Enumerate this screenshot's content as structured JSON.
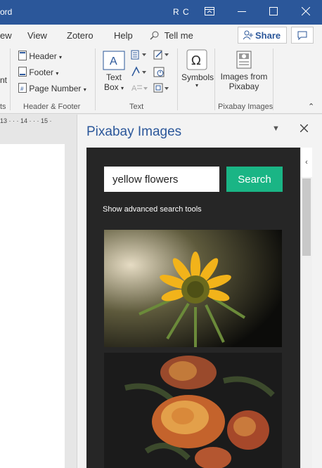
{
  "titlebar": {
    "app_title": "ord",
    "user_initials": "R C",
    "colors": {
      "bg": "#2b579a",
      "fg": "#ffffff"
    }
  },
  "tabs": {
    "items": [
      "ew",
      "View",
      "Zotero",
      "Help"
    ],
    "tell_me": "Tell me",
    "share": "Share"
  },
  "ribbon": {
    "insert": {
      "cut_label": "nt",
      "header": "Header",
      "footer": "Footer",
      "page_number": "Page Number",
      "text_box_1": "Text",
      "text_box_2": "Box",
      "symbols": "Symbols",
      "images_from_1": "Images from",
      "images_from_2": "Pixabay"
    },
    "groups": {
      "left_cut": "ts",
      "header_footer": "Header & Footer",
      "text": "Text",
      "pixabay": "Pixabay Images"
    }
  },
  "ruler": {
    "marks": "13 · · · 14 · · · 15 ·"
  },
  "pane": {
    "title": "Pixabay Images",
    "search": {
      "value": "yellow flowers",
      "button": "Search"
    },
    "advanced": "Show advanced search tools",
    "results": [
      {
        "name": "sunflower-image",
        "icon": "yellow-sunflower"
      },
      {
        "name": "roses-image",
        "icon": "orange-roses"
      }
    ],
    "colors": {
      "accent": "#1ab585",
      "panel_bg": "#262626",
      "title": "#2b579a"
    }
  }
}
